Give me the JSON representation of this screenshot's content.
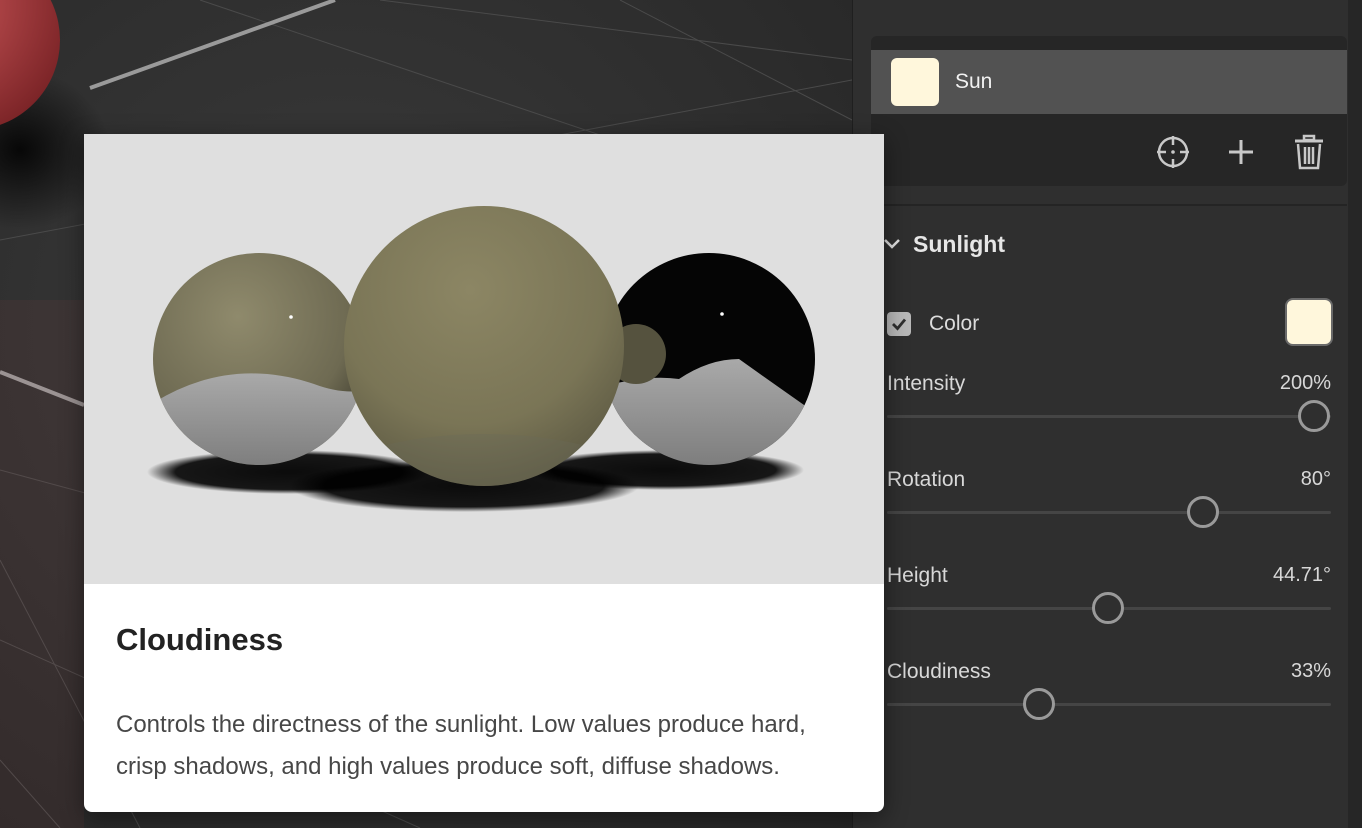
{
  "lights": {
    "items": [
      {
        "name": "Sun",
        "color": "#fff7dc",
        "selected": true
      }
    ],
    "toolbar": {
      "target_icon": "crosshair-icon",
      "add_icon": "plus-icon",
      "delete_icon": "trash-icon"
    }
  },
  "sunlight": {
    "title": "Sunlight",
    "color_label": "Color",
    "color_enabled": true,
    "color_value": "#fff7dc",
    "sliders": [
      {
        "label": "Intensity",
        "value": "200%",
        "fraction": 0.96
      },
      {
        "label": "Rotation",
        "value": "80°",
        "fraction": 0.71
      },
      {
        "label": "Height",
        "value": "44.71°",
        "fraction": 0.495
      },
      {
        "label": "Cloudiness",
        "value": "33%",
        "fraction": 0.34
      }
    ]
  },
  "tooltip": {
    "title": "Cloudiness",
    "description": "Controls the directness of the sunlight. Low values produce hard, crisp shadows, and high values produce soft, diffuse shadows."
  },
  "colors": {
    "panel_bg": "#2f2f2f",
    "selected_row": "#525252",
    "handle": "#9a9a9a",
    "viewport_accent": "#b8474a"
  }
}
